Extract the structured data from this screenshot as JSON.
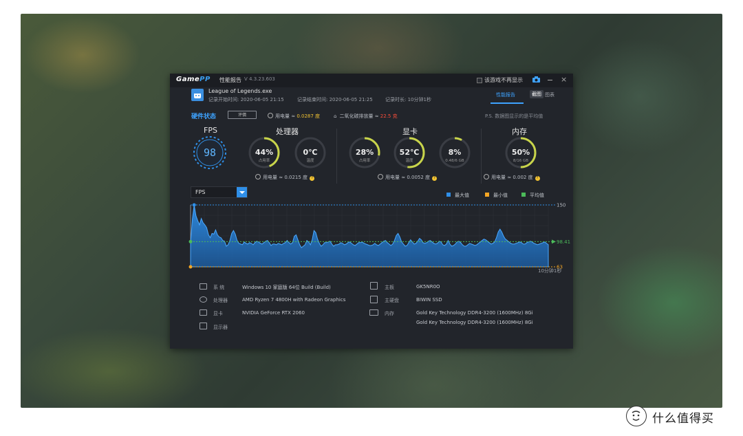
{
  "window": {
    "logo": {
      "game": "Game",
      "pp": "PP"
    },
    "title": "性能报告",
    "version": "V 4.3.23.603",
    "hide_label": "该游戏不再显示"
  },
  "app": {
    "name": "League of Legends.exe",
    "record_start": "记录开始时间: 2020-06-05 21:15",
    "record_end": "记录结束时间: 2020-06-05 21:25",
    "record_length": "记录时长: 10分钟1秒"
  },
  "tabs": {
    "report": "性能报告",
    "screenshot": "截图",
    "chart": "图表"
  },
  "hardware": {
    "title": "硬件状态",
    "eval_button": "评價",
    "power_prefix": "用电量 ≈ ",
    "power_total": "0.0287 度",
    "co2_prefix": "二氧化碳排放量 ≈ ",
    "co2_value": "22.5 克",
    "ps_note": "P.S. 数据图显示的是平均值"
  },
  "sections": {
    "fps": "FPS",
    "cpu": "处理器",
    "gpu": "显卡",
    "mem": "内存"
  },
  "gauges": {
    "fps": {
      "value": "98",
      "level": 0.65
    },
    "cpu_usage": {
      "value": "44%",
      "label": "占用率",
      "level": 0.44
    },
    "cpu_temp": {
      "value": "0℃",
      "label": "温度",
      "level": 0.0
    },
    "gpu_usage": {
      "value": "28%",
      "label": "占用率",
      "level": 0.28
    },
    "gpu_temp": {
      "value": "52℃",
      "label": "温度",
      "level": 0.52
    },
    "gpu_mem": {
      "value": "8%",
      "label": "0.48/6 GB",
      "level": 0.08
    },
    "mem": {
      "value": "50%",
      "label": "8/16 GB",
      "level": 0.5
    }
  },
  "power": {
    "cpu": "用电量 ≈ 0.0215 度",
    "gpu": "用电量 ≈ 0.0052 度",
    "mem": "用电量 ≈ 0.002 度"
  },
  "chart_ui": {
    "metric": "FPS",
    "legend_max": "最大值",
    "legend_min": "最小值",
    "legend_avg": "平均值",
    "duration": "10分钟1秒"
  },
  "chart_data": {
    "type": "area",
    "ylim": [
      63,
      150
    ],
    "max": 150,
    "min": 63,
    "avg": 98.41,
    "ticks": [
      "150",
      "98.41",
      "63"
    ],
    "x": [
      0,
      3,
      6,
      9,
      12,
      15,
      18,
      21,
      24,
      27,
      30,
      33,
      36,
      39,
      42,
      45,
      48,
      51,
      54,
      57,
      60,
      63,
      66,
      69,
      72,
      75,
      78,
      81,
      84,
      87,
      90,
      93,
      96,
      99,
      102,
      105,
      108,
      111,
      114,
      117,
      120,
      123,
      126,
      129,
      132,
      135,
      138,
      141,
      144,
      147,
      150,
      153,
      156,
      159,
      162,
      165,
      168,
      171,
      174,
      177,
      180,
      183,
      186,
      189,
      192,
      195,
      198,
      201,
      204,
      207,
      210,
      213,
      216,
      219,
      222,
      225,
      228,
      231,
      234,
      237,
      240,
      243,
      246,
      249,
      252,
      255,
      258,
      261,
      264,
      267,
      270,
      273,
      276,
      279,
      282,
      285,
      288,
      291,
      294,
      297,
      300,
      303,
      306,
      309,
      312,
      315,
      318,
      321,
      324,
      327,
      330,
      333,
      336,
      339,
      342,
      345,
      348,
      351,
      354,
      357,
      360,
      363,
      366,
      369,
      372,
      375,
      378,
      381,
      384,
      387,
      390,
      393,
      396,
      399,
      402,
      405,
      408,
      411,
      414,
      417,
      420,
      423,
      426,
      429,
      432,
      435,
      438,
      441,
      444,
      447,
      450,
      453,
      456,
      459,
      462,
      465,
      468,
      471,
      474,
      477,
      480,
      483,
      486,
      489,
      492,
      495,
      498,
      501,
      504,
      507,
      510,
      513,
      516,
      519,
      522,
      525,
      528,
      531,
      534,
      537,
      540,
      543,
      546,
      549,
      552,
      555,
      558,
      561,
      564,
      567,
      570,
      573,
      576,
      579,
      582,
      585,
      588,
      591,
      594,
      597,
      600
    ],
    "values": [
      96,
      130,
      150,
      135,
      128,
      122,
      131,
      125,
      122,
      118,
      108,
      104,
      110,
      109,
      115,
      108,
      105,
      104,
      100,
      99,
      92,
      94,
      100,
      110,
      114,
      109,
      100,
      96,
      95,
      94,
      98,
      96,
      95,
      97,
      96,
      94,
      97,
      99,
      98,
      96,
      95,
      97,
      99,
      100,
      97,
      93,
      95,
      95,
      94,
      96,
      95,
      94,
      96,
      97,
      100,
      97,
      95,
      97,
      106,
      108,
      101,
      94,
      90,
      92,
      94,
      100,
      98,
      94,
      101,
      114,
      111,
      102,
      96,
      92,
      94,
      97,
      97,
      98,
      99,
      95,
      92,
      94,
      94,
      95,
      97,
      96,
      94,
      95,
      97,
      98,
      96,
      94,
      93,
      95,
      97,
      97,
      98,
      96,
      95,
      94,
      93,
      93,
      94,
      96,
      94,
      93,
      95,
      97,
      99,
      100,
      97,
      95,
      93,
      95,
      100,
      107,
      110,
      105,
      98,
      95,
      92,
      93,
      97,
      101,
      98,
      95,
      96,
      99,
      103,
      101,
      97,
      96,
      97,
      99,
      100,
      98,
      96,
      95,
      96,
      99,
      98,
      94,
      93,
      95,
      100,
      95,
      92,
      93,
      95,
      98,
      99,
      97,
      94,
      92,
      92,
      94,
      96,
      95,
      94,
      93,
      94,
      96,
      98,
      100,
      102,
      101,
      99,
      97,
      95,
      96,
      98,
      104,
      112,
      116,
      112,
      106,
      102,
      100,
      98,
      96,
      95,
      95,
      96,
      97,
      98,
      97,
      95,
      95,
      97,
      98,
      99,
      98,
      96,
      95,
      94,
      95,
      96,
      97,
      98,
      96,
      94
    ]
  },
  "sysinfo": {
    "os_label": "系 统",
    "os_value": "Windows 10 家庭版 64位   Build (Build)",
    "cpu_label": "处理器",
    "cpu_value": "AMD Ryzen 7 4800H with Radeon Graphics",
    "gpu_label": "显卡",
    "gpu_value": "NVIDIA GeForce RTX 2060",
    "monitor_label": "显示器",
    "board_label": "主板",
    "board_value": "GK5NR0O",
    "disk_label": "主硬盘",
    "disk_value": "BIWIN SSD",
    "ram_label": "内存",
    "ram_value1": "Gold Key Technology DDR4-3200 (1600MHz) 8Gi",
    "ram_value2": "Gold Key Technology DDR4-3200 (1600MHz) 8Gi"
  },
  "colors": {
    "accent": "#3ea3ff",
    "max": "#2f8fe8",
    "min": "#f5a623",
    "avg": "#4cbb5a",
    "gauge": "#c8d44a"
  },
  "watermark": {
    "text": "什么值得买",
    "icon": "smzdm-logo-icon"
  }
}
